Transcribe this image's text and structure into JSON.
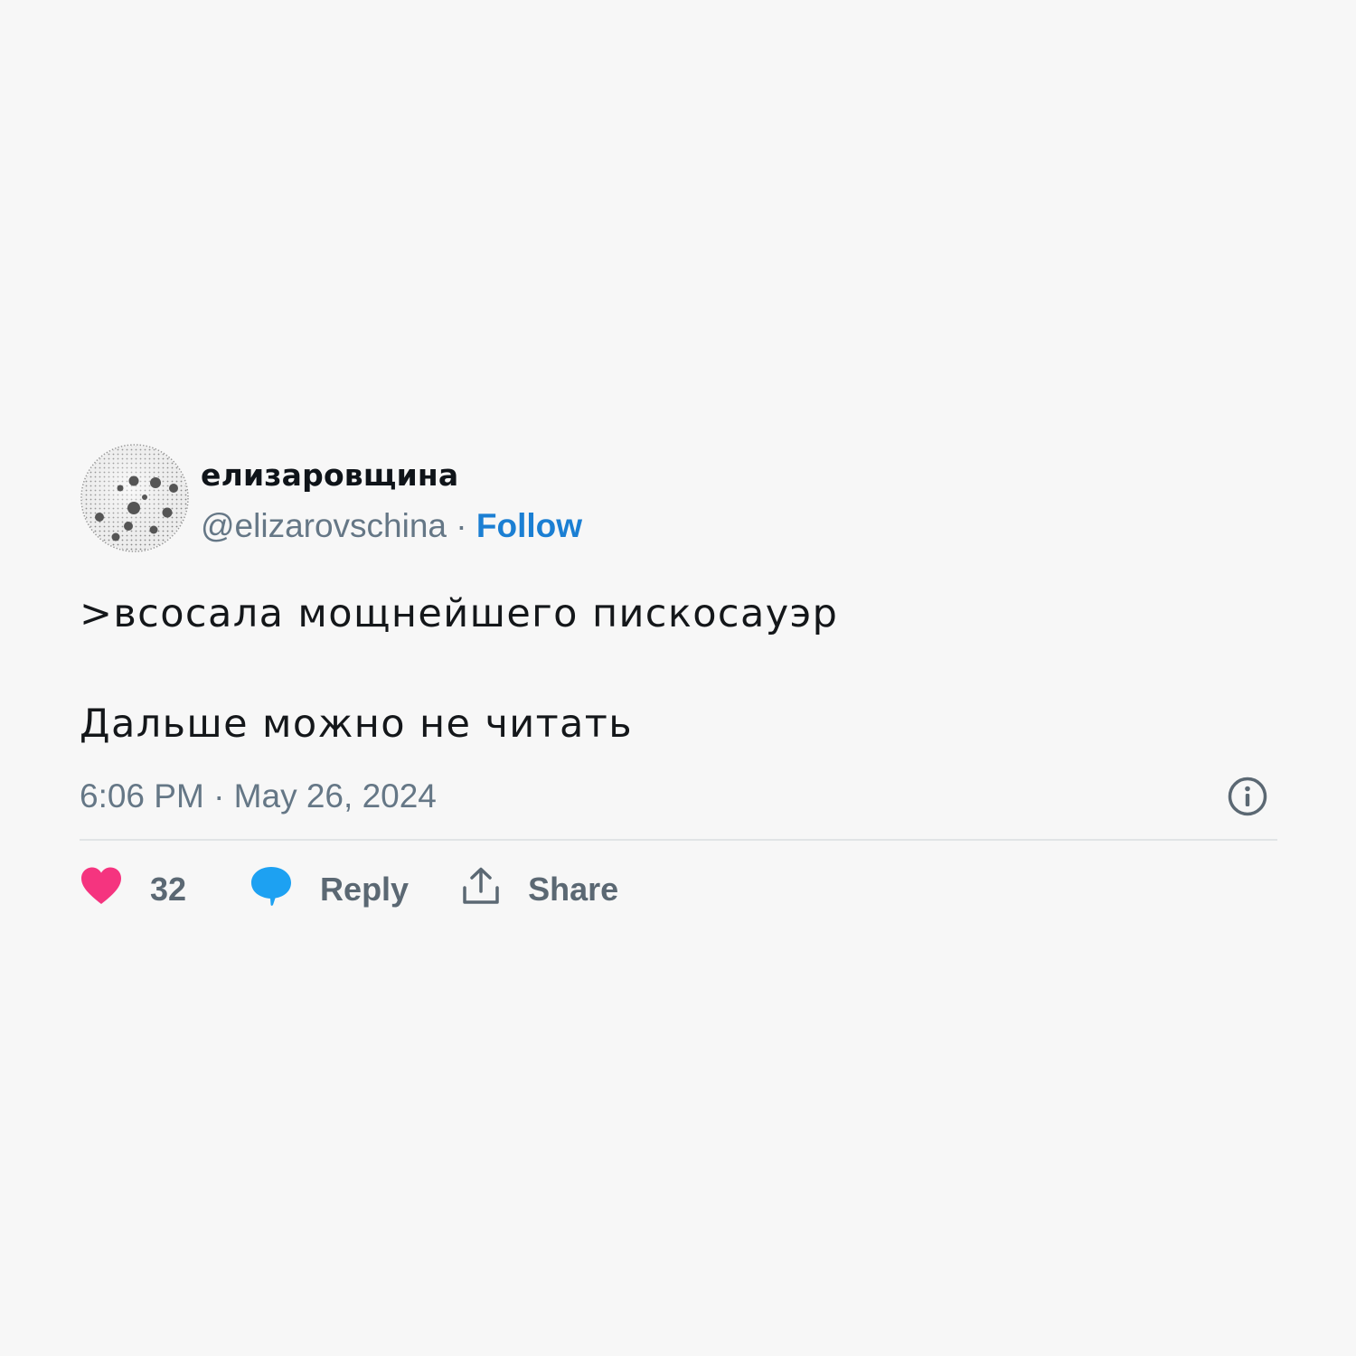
{
  "tweet": {
    "display_name": "елизаровщина",
    "handle": "@elizarovschina",
    "separator": " · ",
    "follow_label": "Follow",
    "text_line1": ">всосала мощнейшего пискосауэр",
    "text_line2": "Дальше можно не читать",
    "timestamp": "6:06 PM · May 26, 2024"
  },
  "actions": {
    "like_count": "32",
    "reply_label": "Reply",
    "share_label": "Share"
  },
  "icons": {
    "avatar": "dotted-sphere-avatar",
    "info": "info-icon",
    "like": "heart-icon",
    "reply": "speech-bubble-icon",
    "share": "share-upload-icon"
  },
  "colors": {
    "background": "#f7f7f7",
    "follow": "#1b7fd3",
    "heart": "#f5347f",
    "reply_bubble": "#1da1f2",
    "secondary_text": "#657786"
  }
}
